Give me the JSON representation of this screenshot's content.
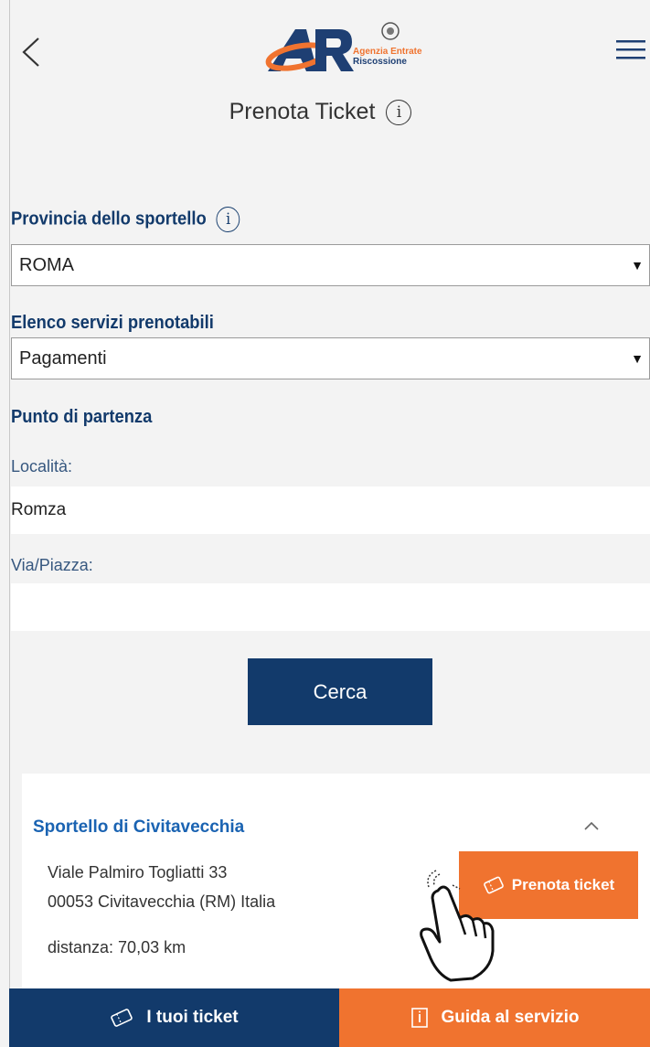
{
  "header": {
    "logo_brand_line1": "Agenzia Entrate",
    "logo_brand_line2": "Riscossione",
    "page_title": "Prenota Ticket"
  },
  "form": {
    "provincia_label": "Provincia dello sportello",
    "provincia_value": "ROMA",
    "servizi_label": "Elenco servizi prenotabili",
    "servizi_value": "Pagamenti",
    "partenza_label": "Punto di partenza",
    "localita_label": "Località:",
    "localita_value": "Romza",
    "via_label": "Via/Piazza:",
    "via_value": "",
    "search_button": "Cerca"
  },
  "result": {
    "title": "Sportello di Civitavecchia",
    "address_line1": "Viale Palmiro Togliatti 33",
    "address_line2": "00053 Civitavecchia (RM) Italia",
    "distance": "distanza: 70,03 km",
    "book_button": "Prenota ticket"
  },
  "bottom_bar": {
    "my_tickets": "I tuoi ticket",
    "guide": "Guida al servizio"
  },
  "colors": {
    "primary": "#123a6b",
    "accent": "#f0732f",
    "link": "#1a63b2"
  },
  "icons": [
    "back-arrow-icon",
    "hamburger-menu-icon",
    "info-icon",
    "chevron-up-icon",
    "ticket-icon",
    "guide-book-icon",
    "hand-pointer-icon"
  ]
}
